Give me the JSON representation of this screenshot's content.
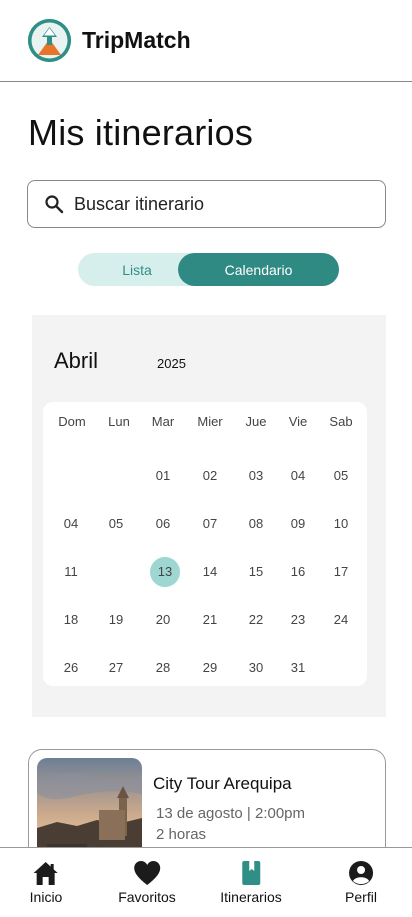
{
  "app": {
    "title": "TripMatch",
    "accent": "#2f8a84"
  },
  "page": {
    "title": "Mis itinerarios"
  },
  "search": {
    "placeholder": "Buscar itinerario",
    "icon": "search-icon"
  },
  "view_toggle": {
    "options": [
      "Lista",
      "Calendario"
    ],
    "selected": "Calendario"
  },
  "calendar": {
    "month": "Abril",
    "year": "2025",
    "weekdays": [
      "Dom",
      "Lun",
      "Mar",
      "Mier",
      "Jue",
      "Vie",
      "Sab"
    ],
    "selected_day": "13",
    "weeks": [
      [
        "",
        "",
        "01",
        "02",
        "03",
        "04",
        "05"
      ],
      [
        "04",
        "05",
        "06",
        "07",
        "08",
        "09",
        "10"
      ],
      [
        "11",
        "",
        "13",
        "14",
        "15",
        "16",
        "17"
      ],
      [
        "18",
        "19",
        "20",
        "21",
        "22",
        "23",
        "24"
      ],
      [
        "26",
        "27",
        "28",
        "29",
        "30",
        "31",
        ""
      ]
    ]
  },
  "itinerary": {
    "title": "City Tour Arequipa",
    "date": "13 de agosto | 2:00pm",
    "duration": "2 horas"
  },
  "bottom_nav": {
    "items": [
      {
        "label": "Inicio",
        "icon": "home-icon"
      },
      {
        "label": "Favoritos",
        "icon": "heart-icon"
      },
      {
        "label": "Itinerarios",
        "icon": "book-icon",
        "active": true
      },
      {
        "label": "Perfil",
        "icon": "user-icon"
      }
    ]
  }
}
